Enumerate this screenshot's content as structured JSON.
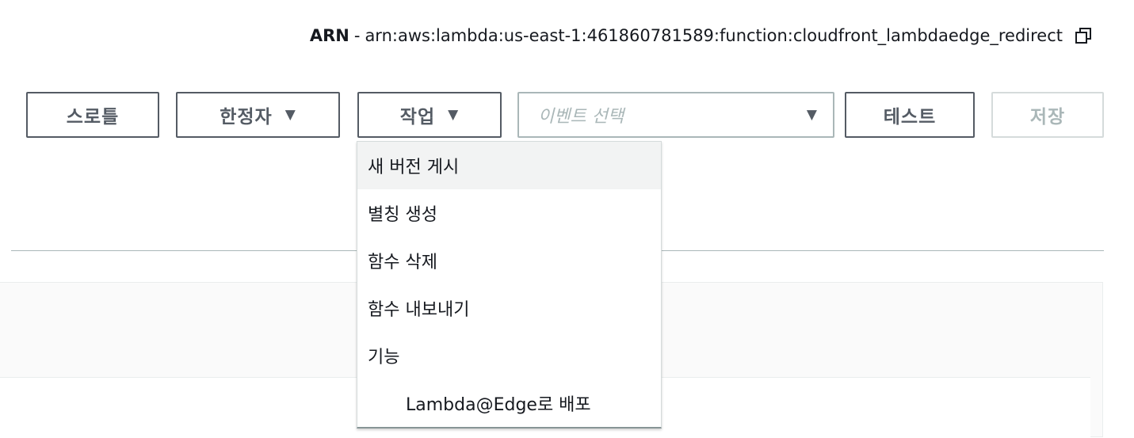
{
  "arn": {
    "label": "ARN",
    "separator": "-",
    "value": "arn:aws:lambda:us-east-1:461860781589:function:cloudfront_lambdaedge_redirect",
    "copy_icon": "copy-icon"
  },
  "toolbar": {
    "throttle_label": "스로틀",
    "qualifiers_label": "한정자",
    "actions_label": "작업",
    "event_placeholder": "이벤트 선택",
    "test_label": "테스트",
    "save_label": "저장",
    "caret": "▼"
  },
  "actions_menu": {
    "items": [
      "새 버전 게시",
      "별칭 생성",
      "함수 삭제",
      "함수 내보내기",
      "기능",
      "Lambda@Edge로 배포"
    ]
  }
}
